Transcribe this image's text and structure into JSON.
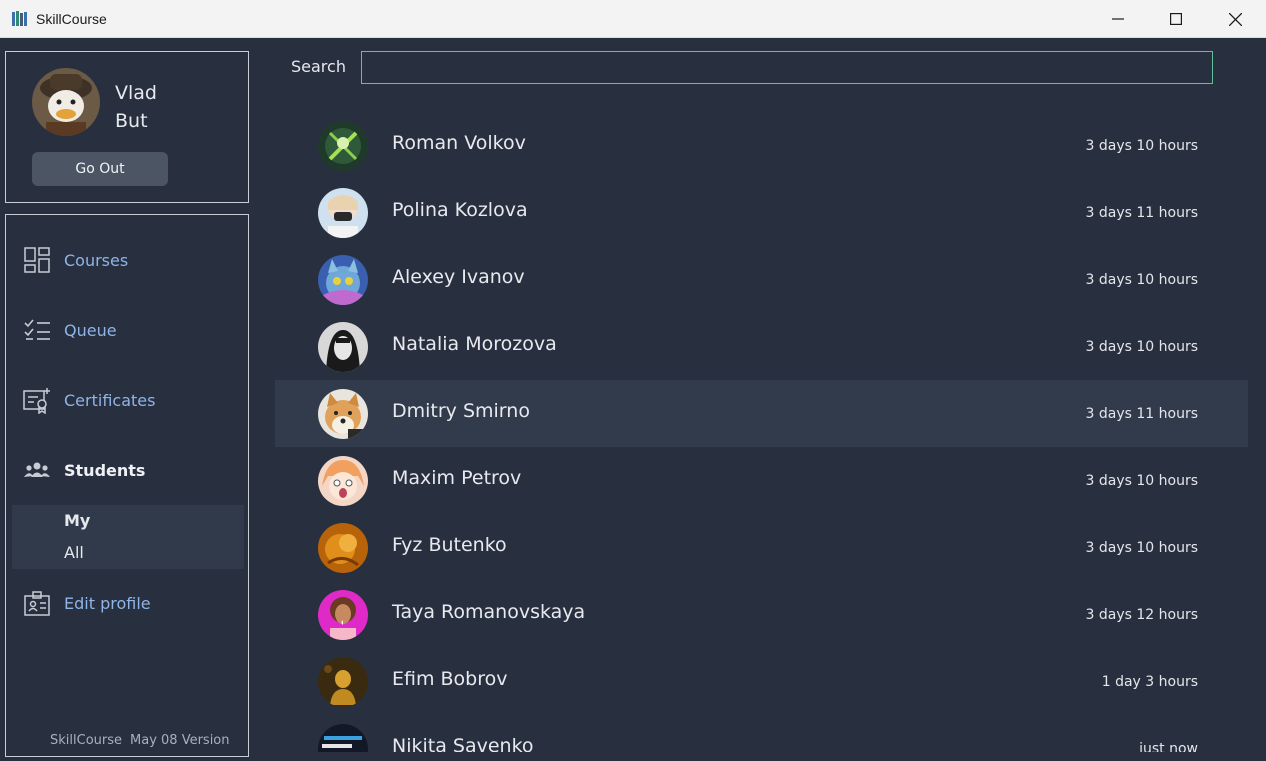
{
  "window": {
    "title": "SkillCourse",
    "minimize_icon": "minimize-icon",
    "maximize_icon": "maximize-icon",
    "close_icon": "close-icon"
  },
  "profile": {
    "first_name": "Vlad",
    "last_name": "But",
    "logout_label": "Go Out"
  },
  "nav": {
    "items": [
      {
        "label": "Courses",
        "icon": "grid-icon"
      },
      {
        "label": "Queue",
        "icon": "checklist-icon"
      },
      {
        "label": "Certificates",
        "icon": "certificate-icon"
      },
      {
        "label": "Students",
        "icon": "people-icon"
      },
      {
        "label": "Edit profile",
        "icon": "id-badge-icon"
      }
    ],
    "students_sub": [
      {
        "label": "My"
      },
      {
        "label": "All"
      }
    ]
  },
  "footer": {
    "app_name": "SkillCourse",
    "version": "May 08 Version"
  },
  "search": {
    "label": "Search",
    "value": ""
  },
  "students": [
    {
      "name": "Roman Volkov",
      "time": "3 days 10 hours"
    },
    {
      "name": "Polina Kozlova",
      "time": "3 days 11 hours"
    },
    {
      "name": "Alexey Ivanov",
      "time": "3 days 10 hours"
    },
    {
      "name": "Natalia Morozova",
      "time": "3 days 10 hours"
    },
    {
      "name": "Dmitry Smirno",
      "time": "3 days 11 hours"
    },
    {
      "name": "Maxim Petrov",
      "time": "3 days 10 hours"
    },
    {
      "name": "Fyz Butenko",
      "time": "3 days 10 hours"
    },
    {
      "name": "Taya Romanovskaya",
      "time": "3 days 12 hours"
    },
    {
      "name": "Efim Bobrov",
      "time": "1 day 3 hours"
    },
    {
      "name": "Nikita Savenko",
      "time": "just now"
    }
  ],
  "colors": {
    "background": "#283040",
    "accent_link": "#8fb4e6",
    "search_border": "#5fc29a",
    "selected_row": "#313b4c"
  }
}
